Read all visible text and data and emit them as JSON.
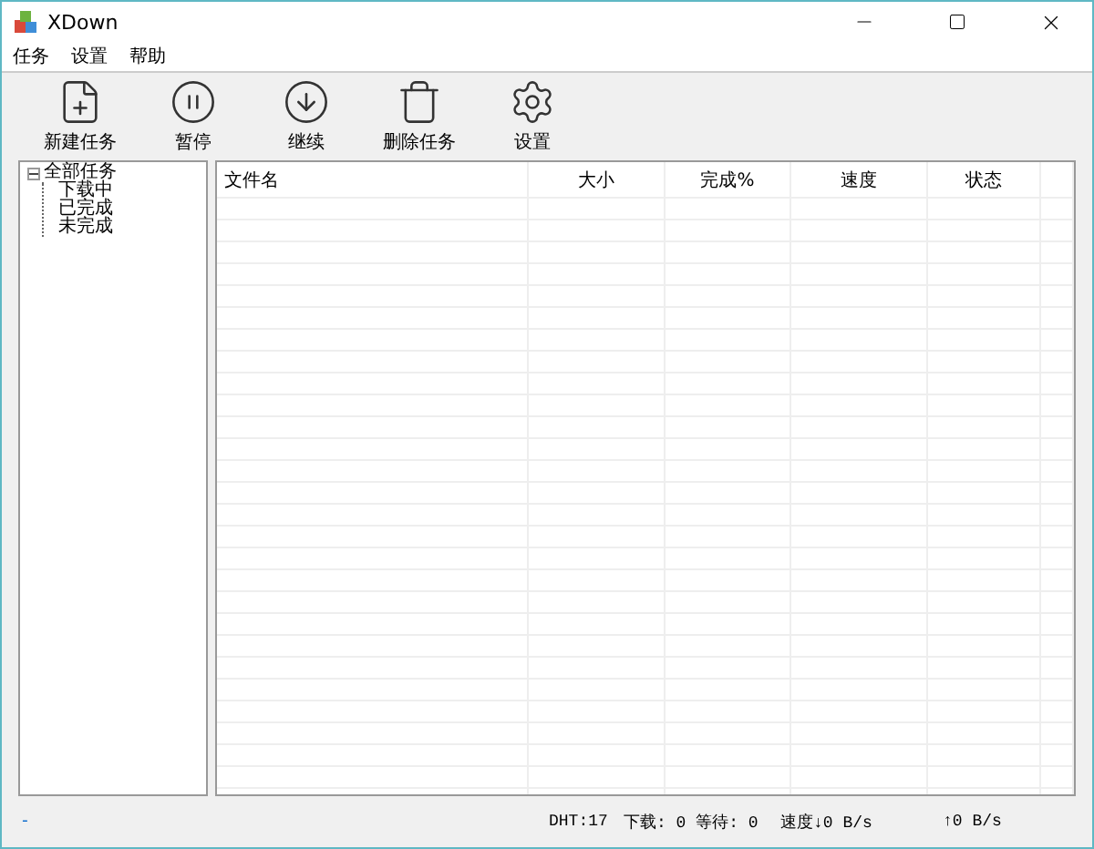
{
  "window": {
    "title": "XDown"
  },
  "menu": [
    "任务",
    "设置",
    "帮助"
  ],
  "toolbar": [
    {
      "kind": "new",
      "label": "新建任务"
    },
    {
      "kind": "pause",
      "label": "暂停"
    },
    {
      "kind": "resume",
      "label": "继续"
    },
    {
      "kind": "delete",
      "label": "删除任务"
    },
    {
      "kind": "settings",
      "label": "设置"
    }
  ],
  "tree": {
    "label": "全部任务",
    "expanded": true,
    "children": [
      {
        "label": "下载中"
      },
      {
        "label": "已完成"
      },
      {
        "label": "未完成"
      }
    ]
  },
  "table": {
    "columns": [
      {
        "label": "文件名"
      },
      {
        "label": "大小"
      },
      {
        "label": "完成%"
      },
      {
        "label": "速度"
      },
      {
        "label": "状态"
      }
    ]
  },
  "status_bar": {
    "left": "-",
    "items": [
      "DHT:17",
      "下载: 0 等待: 0",
      "速度↓0 B/s",
      "↑0 B/s"
    ]
  }
}
